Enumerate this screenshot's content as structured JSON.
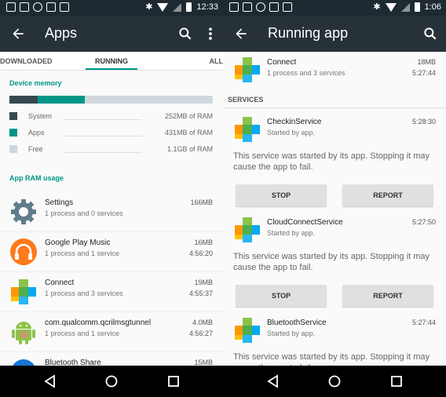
{
  "left": {
    "status_time": "12:33",
    "title": "Apps",
    "tabs": [
      "DOWNLOADED",
      "RUNNING",
      "ALL"
    ],
    "device_memory_label": "Device memory",
    "memory": {
      "system": {
        "name": "System",
        "value": "252MB of RAM",
        "color": "#37474f"
      },
      "apps": {
        "name": "Apps",
        "value": "431MB of RAM",
        "color": "#009688"
      },
      "free": {
        "name": "Free",
        "value": "1.1GB of RAM",
        "color": "#cfd8dc"
      }
    },
    "app_ram_label": "App RAM usage",
    "apps": [
      {
        "name": "Settings",
        "sub": "1 process and 0 services",
        "size": "166MB",
        "time": "",
        "icon": "settings-gear-icon"
      },
      {
        "name": "Google Play Music",
        "sub": "1 process and 1 service",
        "size": "16MB",
        "time": "4:56:20",
        "icon": "headphones-icon"
      },
      {
        "name": "Connect",
        "sub": "1 process and 3 services",
        "size": "19MB",
        "time": "4:55:37",
        "icon": "connect-cross-icon"
      },
      {
        "name": "com.qualcomm.qcrilmsgtunnel",
        "sub": "1 process and 1 service",
        "size": "4.0MB",
        "time": "4:56:27",
        "icon": "android-icon"
      },
      {
        "name": "Bluetooth Share",
        "sub": "",
        "size": "15MB",
        "time": "",
        "icon": "bluetooth-share-icon"
      }
    ]
  },
  "right": {
    "status_time": "1:06",
    "title": "Running app",
    "app": {
      "name": "Connect",
      "sub": "1 process and 3 services",
      "size": "18MB",
      "time": "5:27:44"
    },
    "services_label": "SERVICES",
    "services": [
      {
        "name": "CheckinService",
        "sub": "Started by app.",
        "time": "5:28:30",
        "desc": "This service was started by its app. Stopping it may cause the app to fail.",
        "stop": "STOP",
        "report": "REPORT"
      },
      {
        "name": "CloudConnectService",
        "sub": "Started by app.",
        "time": "5:27:50",
        "desc": "This service was started by its app. Stopping it may cause the app to fail.",
        "stop": "STOP",
        "report": "REPORT"
      },
      {
        "name": "BluetoothService",
        "sub": "Started by app.",
        "time": "5:27:44",
        "desc": "This service was started by its app. Stopping it may cause the app to fail."
      }
    ]
  },
  "colors": {
    "accent": "#009688",
    "appbar": "#263238",
    "statusbar": "#1e2a31"
  }
}
